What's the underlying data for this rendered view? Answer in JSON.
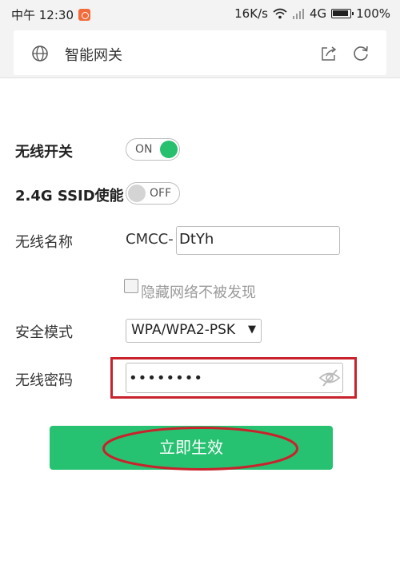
{
  "status_bar": {
    "time": "中午 12:30",
    "speed": "16K/s",
    "network": "4G",
    "battery": "100%"
  },
  "browser": {
    "title": "智能网关",
    "icons": [
      "globe-icon",
      "share-icon",
      "refresh-icon"
    ]
  },
  "form": {
    "wireless_switch": {
      "label": "无线开关",
      "state": "ON"
    },
    "ssid_enable": {
      "label": "2.4G SSID使能",
      "state": "OFF"
    },
    "wireless_name": {
      "label": "无线名称",
      "prefix": "CMCC-",
      "value": "DtYh"
    },
    "hide_network": {
      "label": "隐藏网络不被发现",
      "checked": false
    },
    "security_mode": {
      "label": "安全模式",
      "value": "WPA/WPA2-PSK"
    },
    "wireless_password": {
      "label": "无线密码",
      "value": "••••••••"
    },
    "submit_label": "立即生效"
  },
  "colors": {
    "accent_green": "#27c271",
    "annotation_red": "#c8232c"
  }
}
